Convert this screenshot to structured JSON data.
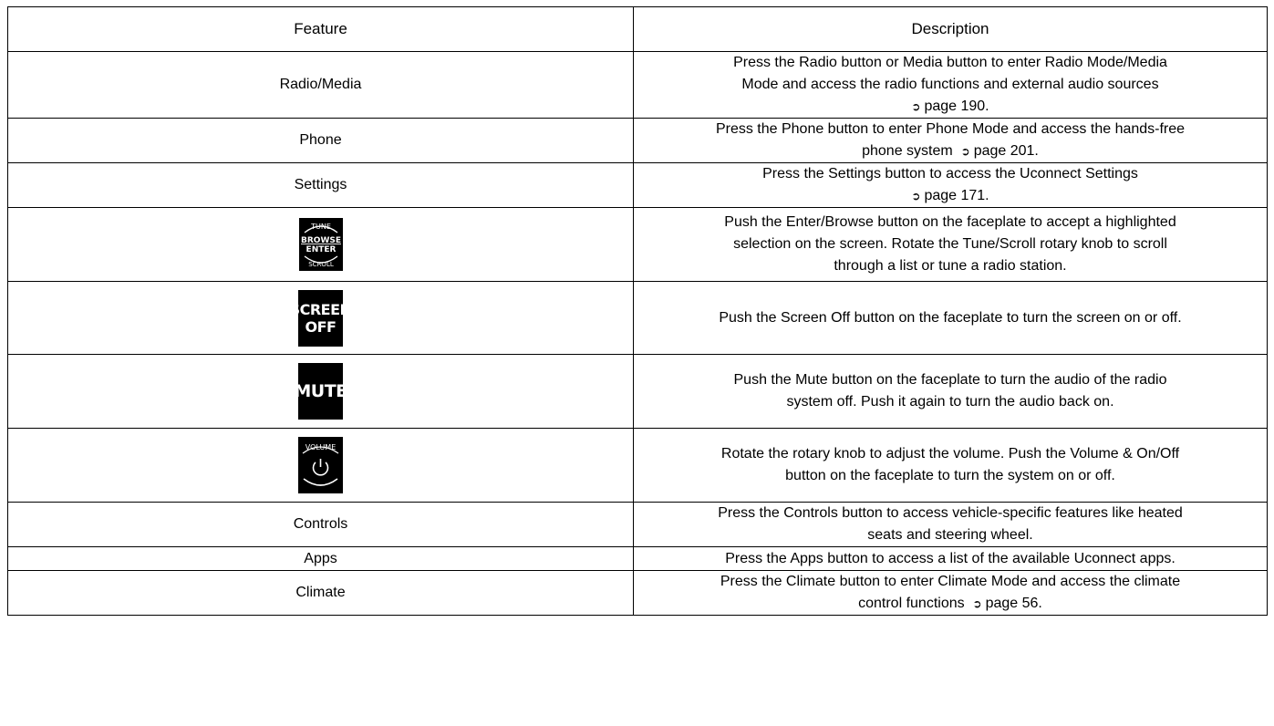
{
  "table": {
    "headers": [
      "Feature",
      "Description"
    ],
    "rows": [
      {
        "feature": "Radio/Media",
        "lines": [
          "Press the Radio button or Media button to enter Radio Mode/Media",
          "Mode and access the radio functions and external audio sources"
        ],
        "page": "page 190."
      },
      {
        "feature": "Phone",
        "lines": [
          "Press the Phone button to enter Phone Mode and access the hands-free",
          "phone system"
        ],
        "page": "page 201."
      },
      {
        "feature": "Settings",
        "lines": [
          "Press the Settings button to access the Uconnect Settings"
        ],
        "page": "page 171."
      },
      {
        "feature_icon": "tune-browse-enter-scroll-knob-icon",
        "icon_text": {
          "top": "TUNE",
          "mid1": "BROWSE",
          "mid2": "ENTER",
          "bottom": "SCROLL"
        },
        "lines": [
          "Push the Enter/Browse button on the faceplate to accept a highlighted",
          "selection on the screen. Rotate the Tune/Scroll rotary knob to scroll",
          "through a list or tune a radio station."
        ]
      },
      {
        "feature_icon": "screen-off-button-icon",
        "icon_text": [
          "SCREEN",
          "OFF"
        ],
        "lines": [
          "Push the Screen Off button on the faceplate to turn the screen on or off."
        ]
      },
      {
        "feature_icon": "mute-button-icon",
        "icon_text": "MUTE",
        "lines": [
          "Push the Mute button on the faceplate to turn the audio of the radio",
          "system off. Push it again to turn the audio back on."
        ]
      },
      {
        "feature_icon": "volume-power-knob-icon",
        "icon_text": "VOLUME",
        "lines": [
          "Rotate the rotary knob to adjust the volume. Push the Volume & On/Off",
          "button on the faceplate to turn the system on or off."
        ]
      },
      {
        "feature": "Controls",
        "lines": [
          "Press the Controls button to access vehicle-specific features like heated",
          "seats and steering wheel."
        ]
      },
      {
        "feature": "Apps",
        "lines": [
          "Press the Apps button to access a list of the available Uconnect apps."
        ]
      },
      {
        "feature": "Climate",
        "lines": [
          "Press the Climate button to enter Climate Mode and access the climate",
          "control functions"
        ],
        "page": "page 56."
      }
    ]
  },
  "page_ref_icon": "arrow-right-icon"
}
